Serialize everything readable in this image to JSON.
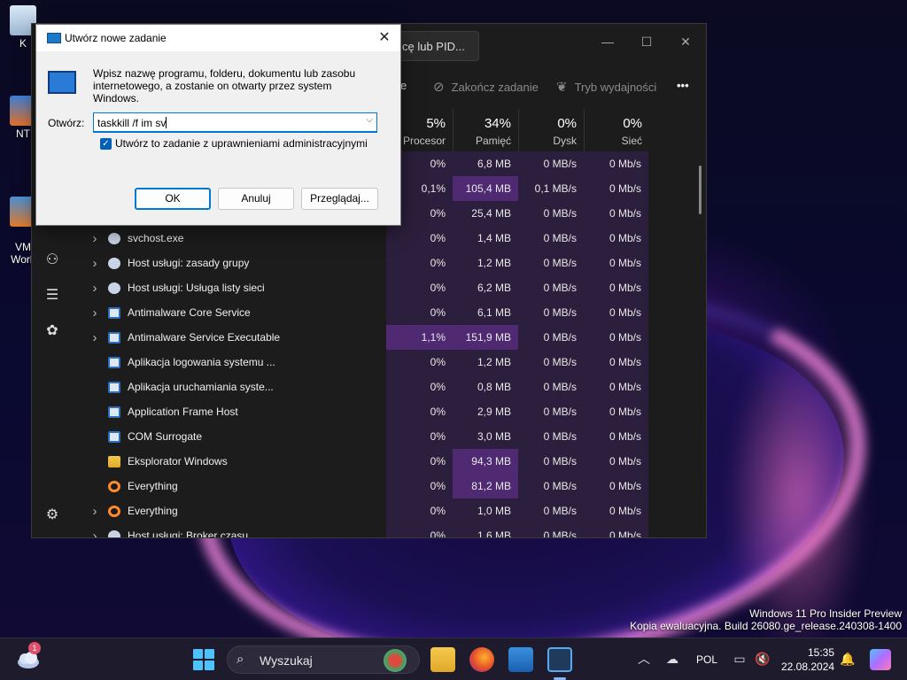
{
  "desktop": {
    "icons": [
      {
        "label": "K"
      },
      {
        "label": "NT"
      },
      {
        "label": "VM\nWork"
      }
    ]
  },
  "task_manager": {
    "search_text": "cę lub PID...",
    "window_controls": [
      "—",
      "☐",
      "✕"
    ],
    "toolbar": {
      "run_new_task_partial": "e",
      "end_task": "Zakończ zadanie",
      "efficiency_mode": "Tryb wydajności",
      "more": "•••"
    },
    "columns": [
      {
        "pct": "5%",
        "label": "Procesor"
      },
      {
        "pct": "34%",
        "label": "Pamięć"
      },
      {
        "pct": "0%",
        "label": "Dysk"
      },
      {
        "pct": "0%",
        "label": "Sieć"
      }
    ],
    "rows": [
      {
        "name": "",
        "expand": false,
        "icon": "",
        "cpu": "0%",
        "mem": "6,8 MB",
        "disk": "0 MB/s",
        "net": "0 Mb/s",
        "cpu_hi": false,
        "mem_hi": false
      },
      {
        "name": "",
        "expand": false,
        "icon": "",
        "cpu": "0,1%",
        "mem": "105,4 MB",
        "disk": "0,1 MB/s",
        "net": "0 Mb/s",
        "cpu_hi": false,
        "mem_hi": true
      },
      {
        "name": "",
        "expand": false,
        "icon": "",
        "cpu": "0%",
        "mem": "25,4 MB",
        "disk": "0 MB/s",
        "net": "0 Mb/s",
        "cpu_hi": false,
        "mem_hi": false
      },
      {
        "name": "svchost.exe",
        "expand": true,
        "icon": "gear-icon",
        "cpu": "0%",
        "mem": "1,4 MB",
        "disk": "0 MB/s",
        "net": "0 Mb/s",
        "cpu_hi": false,
        "mem_hi": false
      },
      {
        "name": "Host usługi: zasady grupy",
        "expand": true,
        "icon": "gear-icon",
        "cpu": "0%",
        "mem": "1,2 MB",
        "disk": "0 MB/s",
        "net": "0 Mb/s",
        "cpu_hi": false,
        "mem_hi": false
      },
      {
        "name": "Host usługi: Usługa listy sieci",
        "expand": true,
        "icon": "gear-icon",
        "cpu": "0%",
        "mem": "6,2 MB",
        "disk": "0 MB/s",
        "net": "0 Mb/s",
        "cpu_hi": false,
        "mem_hi": false
      },
      {
        "name": "Antimalware Core Service",
        "expand": true,
        "icon": "window-icon",
        "cpu": "0%",
        "mem": "6,1 MB",
        "disk": "0 MB/s",
        "net": "0 Mb/s",
        "cpu_hi": false,
        "mem_hi": false
      },
      {
        "name": "Antimalware Service Executable",
        "expand": true,
        "icon": "window-icon",
        "cpu": "1,1%",
        "mem": "151,9 MB",
        "disk": "0 MB/s",
        "net": "0 Mb/s",
        "cpu_hi": true,
        "mem_hi": true
      },
      {
        "name": "Aplikacja logowania systemu ...",
        "expand": false,
        "icon": "window-icon",
        "cpu": "0%",
        "mem": "1,2 MB",
        "disk": "0 MB/s",
        "net": "0 Mb/s",
        "cpu_hi": false,
        "mem_hi": false
      },
      {
        "name": "Aplikacja uruchamiania syste...",
        "expand": false,
        "icon": "window-icon",
        "cpu": "0%",
        "mem": "0,8 MB",
        "disk": "0 MB/s",
        "net": "0 Mb/s",
        "cpu_hi": false,
        "mem_hi": false
      },
      {
        "name": "Application Frame Host",
        "expand": false,
        "icon": "window-icon",
        "cpu": "0%",
        "mem": "2,9 MB",
        "disk": "0 MB/s",
        "net": "0 Mb/s",
        "cpu_hi": false,
        "mem_hi": false
      },
      {
        "name": "COM Surrogate",
        "expand": false,
        "icon": "window-icon",
        "cpu": "0%",
        "mem": "3,0 MB",
        "disk": "0 MB/s",
        "net": "0 Mb/s",
        "cpu_hi": false,
        "mem_hi": false
      },
      {
        "name": "Eksplorator Windows",
        "expand": false,
        "icon": "folder-icon",
        "cpu": "0%",
        "mem": "94,3 MB",
        "disk": "0 MB/s",
        "net": "0 Mb/s",
        "cpu_hi": false,
        "mem_hi": true
      },
      {
        "name": "Everything",
        "expand": false,
        "icon": "magnifier-icon",
        "cpu": "0%",
        "mem": "81,2 MB",
        "disk": "0 MB/s",
        "net": "0 Mb/s",
        "cpu_hi": false,
        "mem_hi": true
      },
      {
        "name": "Everything",
        "expand": true,
        "icon": "magnifier-icon",
        "cpu": "0%",
        "mem": "1,0 MB",
        "disk": "0 MB/s",
        "net": "0 Mb/s",
        "cpu_hi": false,
        "mem_hi": false
      },
      {
        "name": "Host usługi: Broker czasu",
        "expand": true,
        "icon": "gear-icon",
        "cpu": "0%",
        "mem": "1,6 MB",
        "disk": "0 MB/s",
        "net": "0 Mb/s",
        "cpu_hi": false,
        "mem_hi": false
      }
    ]
  },
  "run_dialog": {
    "title": "Utwórz nowe zadanie",
    "description": "Wpisz nazwę programu, folderu, dokumentu lub zasobu internetowego, a zostanie on otwarty przez system Windows.",
    "open_label": "Otwórz:",
    "input_value": "taskkill /f im sv",
    "admin_checkbox_label": "Utwórz to zadanie z uprawnieniami administracyjnymi",
    "admin_checked": true,
    "ok": "OK",
    "cancel": "Anuluj",
    "browse": "Przeglądaj..."
  },
  "watermark": {
    "line1": "Windows 11 Pro Insider Preview",
    "line2": "Kopia ewaluacyjna. Build 26080.ge_release.240308-1400"
  },
  "taskbar": {
    "weather_badge": "1",
    "search_placeholder": "Wyszukaj",
    "language": "POL",
    "time": "15:35",
    "date": "22.08.2024"
  },
  "colors": {
    "accent": "#0078d4",
    "heat_low": "#2c1f3d",
    "heat_mid": "#3b2455",
    "heat_high": "#4f2a73"
  }
}
